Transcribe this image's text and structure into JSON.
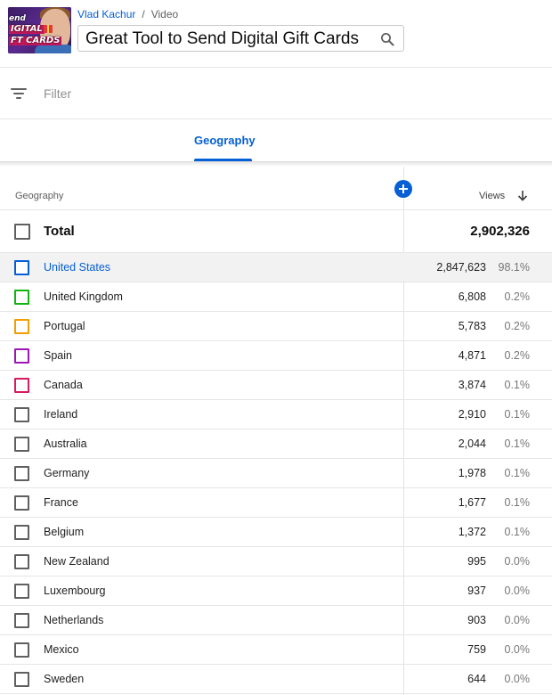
{
  "header": {
    "breadcrumb": {
      "channel": "Vlad Kachur",
      "separator": "/",
      "section": "Video"
    },
    "video_title": "Great Tool to Send Digital Gift Cards",
    "thumbnail": {
      "line1": "end",
      "line2": "IGITAL",
      "line3": "FT CARDS"
    }
  },
  "filter": {
    "placeholder": "Filter",
    "icon": "filter-icon"
  },
  "tabs": [
    {
      "label": "Geography",
      "active": true
    }
  ],
  "table": {
    "columns": {
      "geography": "Geography",
      "views": "Views"
    },
    "sort_icon": "arrow-down-icon",
    "add_icon": "plus-circle-icon",
    "total": {
      "label": "Total",
      "views": "2,902,326"
    },
    "rows": [
      {
        "country": "United States",
        "views": "2,847,623",
        "pct": "98.1%",
        "color": "#065fd4"
      },
      {
        "country": "United Kingdom",
        "views": "6,808",
        "pct": "0.2%",
        "color": "#12b50f"
      },
      {
        "country": "Portugal",
        "views": "5,783",
        "pct": "0.2%",
        "color": "#f29d00"
      },
      {
        "country": "Spain",
        "views": "4,871",
        "pct": "0.2%",
        "color": "#9c18b5"
      },
      {
        "country": "Canada",
        "views": "3,874",
        "pct": "0.1%",
        "color": "#d81b60"
      },
      {
        "country": "Ireland",
        "views": "2,910",
        "pct": "0.1%",
        "color": "#606060"
      },
      {
        "country": "Australia",
        "views": "2,044",
        "pct": "0.1%",
        "color": "#606060"
      },
      {
        "country": "Germany",
        "views": "1,978",
        "pct": "0.1%",
        "color": "#606060"
      },
      {
        "country": "France",
        "views": "1,677",
        "pct": "0.1%",
        "color": "#606060"
      },
      {
        "country": "Belgium",
        "views": "1,372",
        "pct": "0.1%",
        "color": "#606060"
      },
      {
        "country": "New Zealand",
        "views": "995",
        "pct": "0.0%",
        "color": "#606060"
      },
      {
        "country": "Luxembourg",
        "views": "937",
        "pct": "0.0%",
        "color": "#606060"
      },
      {
        "country": "Netherlands",
        "views": "903",
        "pct": "0.0%",
        "color": "#606060"
      },
      {
        "country": "Mexico",
        "views": "759",
        "pct": "0.0%",
        "color": "#606060"
      },
      {
        "country": "Sweden",
        "views": "644",
        "pct": "0.0%",
        "color": "#606060"
      }
    ]
  }
}
